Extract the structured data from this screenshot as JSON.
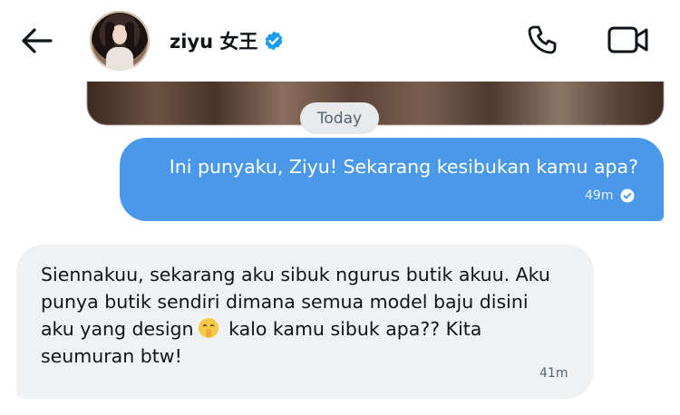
{
  "header": {
    "contact_name": "ziyu 女王",
    "back_icon": "arrow-left-icon",
    "verified_icon": "verified-badge-icon",
    "call_icon": "phone-icon",
    "video_icon": "video-camera-icon",
    "verified_color": "#1d9bf0"
  },
  "conversation": {
    "date_separator": "Today",
    "messages": [
      {
        "direction": "outgoing",
        "text": "Ini punyaku, Ziyu! Sekarang kesibukan kamu apa?",
        "time": "49m",
        "status_icon": "seen-check-icon",
        "bubble_color": "#4a98e9"
      },
      {
        "direction": "incoming",
        "text_before_emoji": "Siennakuu, sekarang aku sibuk ngurus butik akuu. Aku punya butik sendiri dimana semua model baju disini aku yang design",
        "emoji": "shushing-face-emoji",
        "text_after_emoji": " kalo kamu sibuk apa?? Kita seumuran btw!",
        "time": "41m",
        "bubble_color": "#eff1f3"
      }
    ]
  }
}
